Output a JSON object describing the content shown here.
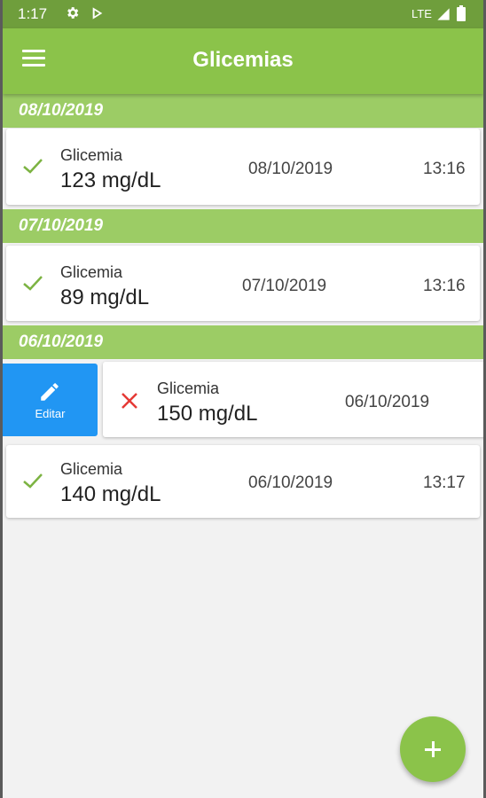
{
  "status_bar": {
    "time": "1:17",
    "network": "LTE",
    "icons": [
      "settings-icon",
      "play-store-icon",
      "signal-icon",
      "battery-icon"
    ]
  },
  "app_bar": {
    "title": "Glicemias",
    "menu_icon": "hamburger-menu-icon"
  },
  "colors": {
    "status_bar": "#6f9e3c",
    "primary": "#8bc34a",
    "section_header": "#9ccc65",
    "edit_action": "#2196f3",
    "ok_check": "#7cb342",
    "error_x": "#e53935"
  },
  "sections": [
    {
      "date": "08/10/2019",
      "entries": [
        {
          "status": "check-icon",
          "label": "Glicemia",
          "value": "123 mg/dL",
          "date": "08/10/2019",
          "time": "13:16"
        }
      ]
    },
    {
      "date": "07/10/2019",
      "entries": [
        {
          "status": "check-icon",
          "label": "Glicemia",
          "value": "89 mg/dL",
          "date": "07/10/2019",
          "time": "13:16"
        }
      ]
    },
    {
      "date": "06/10/2019",
      "entries": [
        {
          "status": "x-icon",
          "label": "Glicemia",
          "value": "150 mg/dL",
          "date": "06/10/2019",
          "time": ""
        },
        {
          "status": "check-icon",
          "label": "Glicemia",
          "value": "140 mg/dL",
          "date": "06/10/2019",
          "time": "13:17"
        }
      ]
    }
  ],
  "swipe_action": {
    "label": "Editar",
    "icon": "pencil-icon"
  },
  "fab": {
    "icon": "plus-icon"
  }
}
